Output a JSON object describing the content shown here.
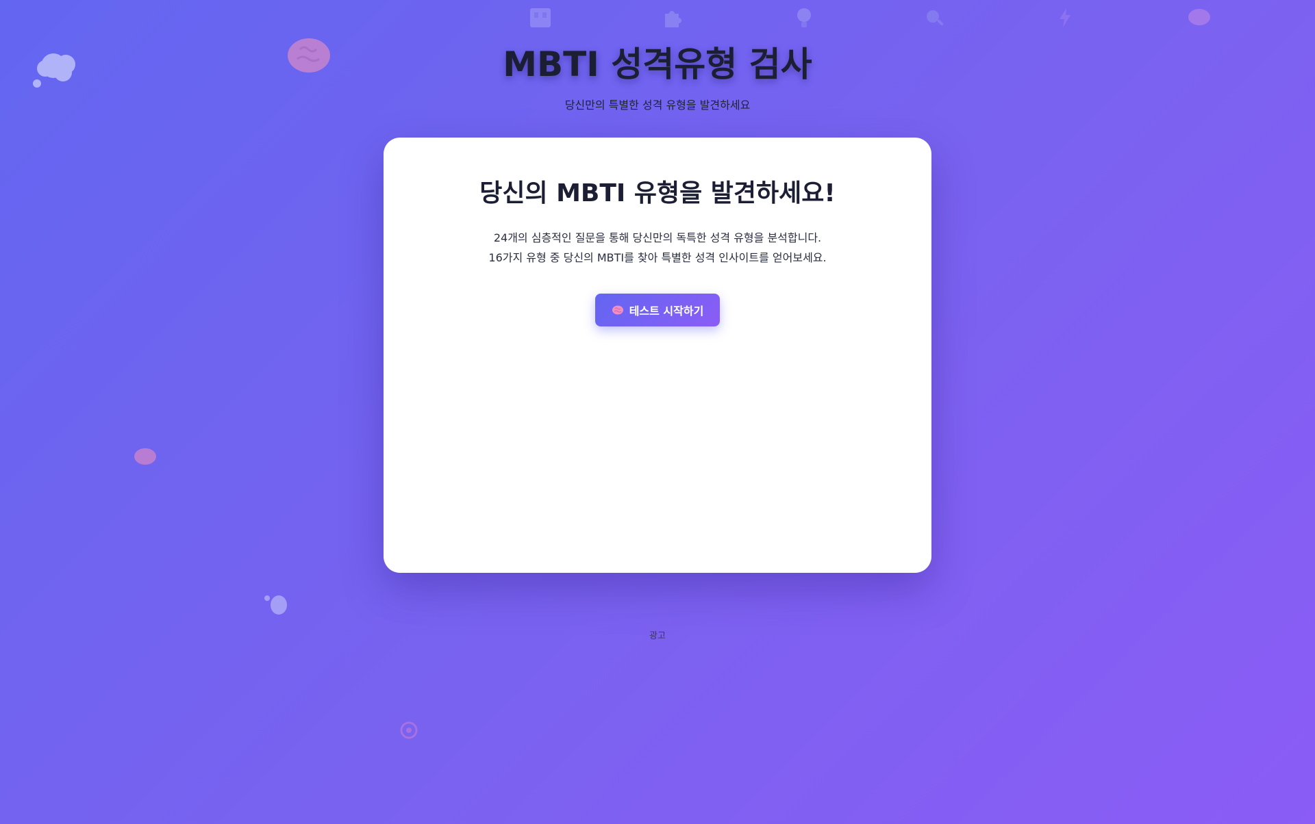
{
  "header": {
    "title": "MBTI 성격유형 검사",
    "subtitle": "당신만의 특별한 성격 유형을 발견하세요"
  },
  "card": {
    "heading": "당신의 MBTI 유형을 발견하세요!",
    "description_line1": "24개의 심층적인 질문을 통해 당신만의 독특한 성격 유형을 분석합니다.",
    "description_line2": "16가지 유형 중 당신의 MBTI를 찾아 특별한 성격 인사이트를 얻어보세요.",
    "start_button_label": "테스트 시작하기",
    "start_button_icon": "brain-icon"
  },
  "footer": {
    "ad_label": "광고"
  },
  "decorations": {
    "icons": [
      "building-icon",
      "puzzle-icon",
      "lightbulb-icon",
      "magnifier-icon",
      "lightning-icon",
      "brain-icon",
      "thought-cloud-icon",
      "brain-icon",
      "brain-icon",
      "brain-icon",
      "target-icon"
    ]
  },
  "colors": {
    "background_start": "#6366f1",
    "background_end": "#8b5cf6",
    "button_start": "#6366f1",
    "button_end": "#8b5cf6",
    "card": "#ffffff"
  }
}
